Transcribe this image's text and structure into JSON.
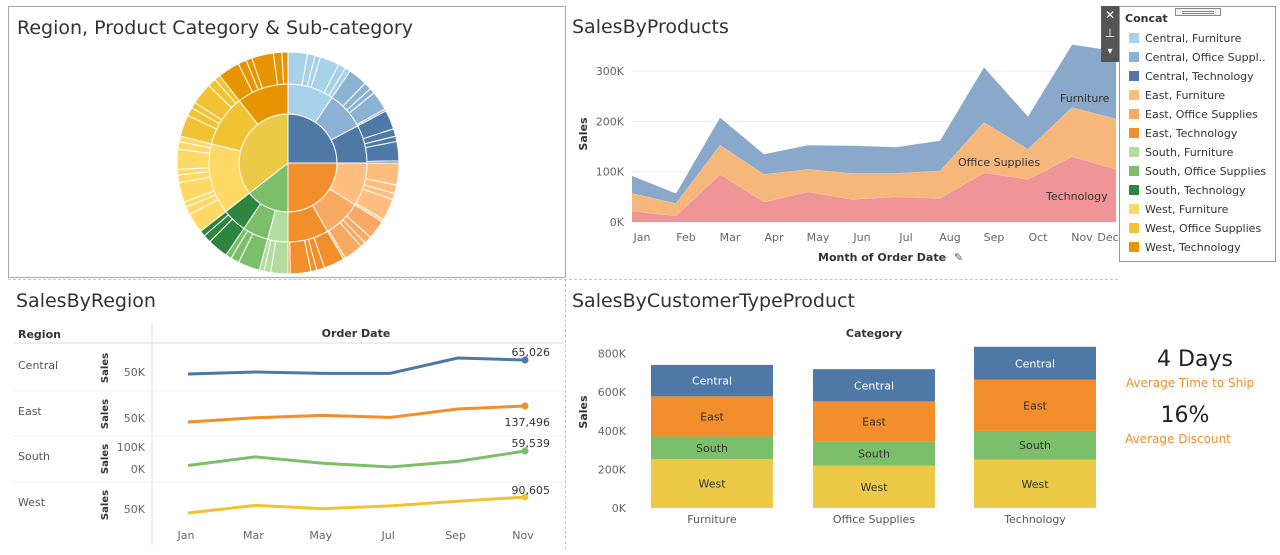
{
  "colors": {
    "central_furniture": "#a8d1ea",
    "central_office": "#8cb2d3",
    "central_technology": "#4e79a7",
    "east_furniture": "#ffbe7d",
    "east_office": "#f8a963",
    "east_technology": "#f28e2b",
    "south_furniture": "#b3dda0",
    "south_office": "#7bbf6a",
    "south_technology": "#2e8540",
    "west_furniture": "#ffd966",
    "west_office": "#f1c232",
    "west_technology": "#e69500",
    "area_furniture": "#8aa8c9",
    "area_office": "#f6b77a",
    "area_technology": "#ef9497",
    "kpi_accent": "#f28e2b"
  },
  "sunburst": {
    "title": "Region, Product Category & Sub-category"
  },
  "sales_by_products": {
    "title": "SalesByProducts",
    "x_title": "Month of Order Date",
    "pin_icon": "pin-icon",
    "chart_data": {
      "type": "area",
      "x": [
        "Jan",
        "Feb",
        "Mar",
        "Apr",
        "May",
        "Jun",
        "Jul",
        "Aug",
        "Sep",
        "Oct",
        "Nov",
        "Dec"
      ],
      "ylabel": "Sales",
      "ylim": [
        0,
        350000
      ],
      "y_ticks": [
        "0K",
        "100K",
        "200K",
        "300K"
      ],
      "series": [
        {
          "name": "Technology",
          "values": [
            22000,
            12000,
            95000,
            40000,
            60000,
            45000,
            50000,
            47000,
            98000,
            85000,
            130000,
            105000
          ]
        },
        {
          "name": "Office Supplies",
          "values": [
            35000,
            25000,
            58000,
            55000,
            45000,
            52000,
            47000,
            55000,
            100000,
            60000,
            98000,
            100000
          ]
        },
        {
          "name": "Furniture",
          "values": [
            35000,
            20000,
            55000,
            40000,
            48000,
            55000,
            52000,
            60000,
            110000,
            65000,
            125000,
            135000
          ]
        }
      ]
    }
  },
  "sales_by_region": {
    "title": "SalesByRegion",
    "region_header": "Region",
    "date_header": "Order Date",
    "sales_label": "Sales",
    "chart_data": {
      "type": "line",
      "x": [
        "Jan",
        "Mar",
        "May",
        "Jul",
        "Sep",
        "Nov"
      ],
      "rows": [
        {
          "name": "Central",
          "tick": "50K",
          "values": [
            44000,
            47000,
            45000,
            45000,
            68000,
            65026
          ],
          "label": "65,026"
        },
        {
          "name": "East",
          "tick": "50K",
          "values": [
            43000,
            68000,
            82000,
            70000,
            120000,
            137496
          ],
          "label": "137,496"
        },
        {
          "name": "South",
          "tick": "100K",
          "tick2": "0K",
          "values": [
            21000,
            44000,
            27000,
            17000,
            32000,
            59539
          ],
          "label": "59,539"
        },
        {
          "name": "West",
          "tick": "50K",
          "values": [
            32000,
            60000,
            48000,
            58000,
            75000,
            90605
          ],
          "label": "90,605"
        }
      ]
    }
  },
  "sales_by_customer": {
    "title": "SalesByCustomerTypeProduct",
    "category_header": "Category",
    "chart_data": {
      "type": "bar",
      "categories": [
        "Furniture",
        "Office Supplies",
        "Technology"
      ],
      "ylabel": "Sales",
      "ylim": [
        0,
        870000
      ],
      "y_ticks": [
        "0K",
        "200K",
        "400K",
        "600K",
        "800K"
      ],
      "series": [
        {
          "name": "West",
          "values": [
            253000,
            220000,
            251000
          ]
        },
        {
          "name": "South",
          "values": [
            117000,
            125000,
            148000
          ]
        },
        {
          "name": "East",
          "values": [
            208000,
            207000,
            265000
          ]
        },
        {
          "name": "Central",
          "values": [
            163000,
            167000,
            171000
          ]
        }
      ]
    }
  },
  "kpis": [
    {
      "value": "4 Days",
      "label": "Average Time to Ship"
    },
    {
      "value": "16%",
      "label": "Average Discount"
    }
  ],
  "legend": {
    "title": "Concat",
    "items": [
      "Central, Furniture",
      "Central, Office Suppl..",
      "Central, Technology",
      "East, Furniture",
      "East, Office Supplies",
      "East, Technology",
      "South, Furniture",
      "South, Office Supplies",
      "South, Technology",
      "West, Furniture",
      "West, Office Supplies",
      "West, Technology"
    ],
    "close_label": "✕",
    "pin_label": "⊥",
    "menu_label": "▾"
  }
}
